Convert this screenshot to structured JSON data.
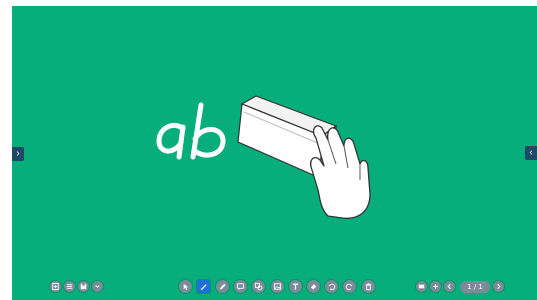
{
  "board": {
    "background": "#07ad7b",
    "handwriting": "ab"
  },
  "nav": {
    "left_arrow": "›",
    "right_arrow": "‹"
  },
  "bottom_left_tools": [
    {
      "name": "new-page-icon"
    },
    {
      "name": "list-icon"
    },
    {
      "name": "save-icon"
    },
    {
      "name": "chevron-down-icon"
    }
  ],
  "center_tools": [
    {
      "name": "select-cursor-icon"
    },
    {
      "name": "pen-icon",
      "active": true
    },
    {
      "name": "highlighter-icon"
    },
    {
      "name": "comment-icon"
    },
    {
      "name": "shape-icon"
    },
    {
      "name": "image-icon"
    },
    {
      "name": "text-icon"
    },
    {
      "name": "eraser-icon"
    },
    {
      "name": "undo-icon"
    },
    {
      "name": "redo-icon"
    },
    {
      "name": "trash-icon"
    }
  ],
  "page_nav": {
    "current": "1 / 1"
  },
  "colors": {
    "toolbar_button": "#7a8b99",
    "active_tool": "#1f6fd6",
    "side_arrow": "#1f4a66"
  }
}
